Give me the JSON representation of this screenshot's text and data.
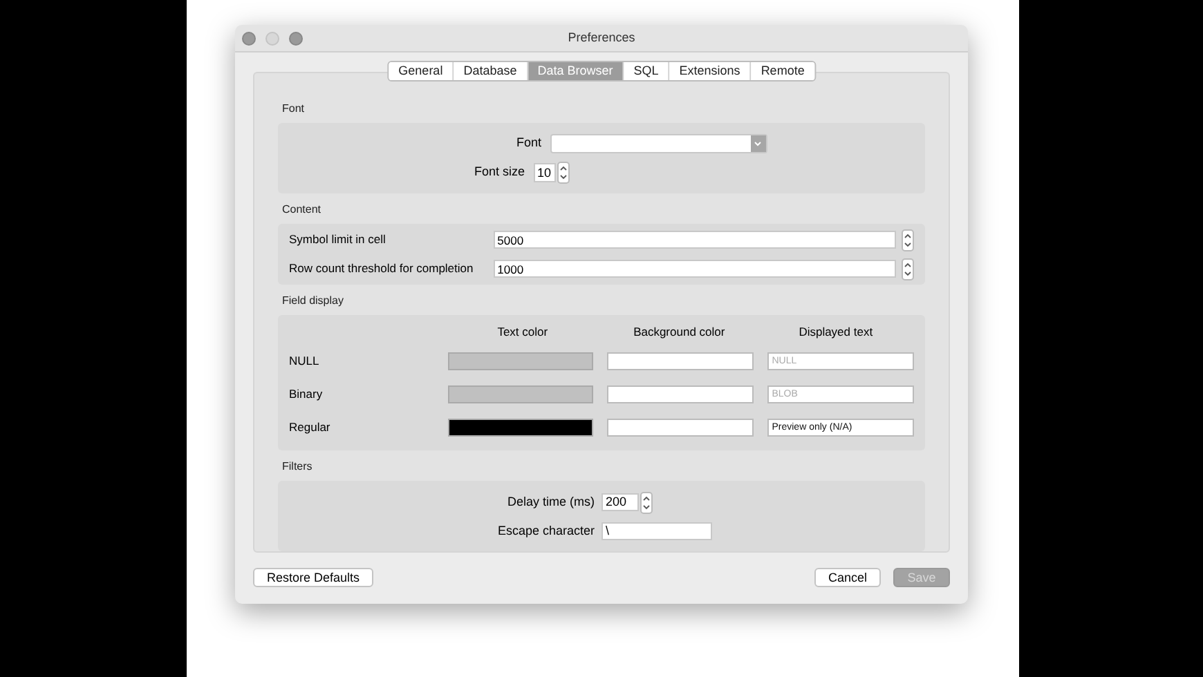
{
  "window": {
    "title": "Preferences"
  },
  "tabs": [
    {
      "label": "General",
      "selected": false
    },
    {
      "label": "Database",
      "selected": false
    },
    {
      "label": "Data Browser",
      "selected": true
    },
    {
      "label": "SQL",
      "selected": false
    },
    {
      "label": "Extensions",
      "selected": false
    },
    {
      "label": "Remote",
      "selected": false
    }
  ],
  "font": {
    "title": "Font",
    "font_label": "Font",
    "font_size_label": "Font size",
    "font_size": "10"
  },
  "content": {
    "title": "Content",
    "rows": [
      {
        "label": "Symbol limit in cell",
        "value": "5000"
      },
      {
        "label": "Row count threshold for completion",
        "value": "1000"
      }
    ]
  },
  "field_display": {
    "title": "Field display",
    "columns": [
      "Text color",
      "Background color",
      "Displayed text"
    ],
    "rows": [
      {
        "label": "NULL",
        "color": "#c0c0c0",
        "text": "NULL"
      },
      {
        "label": "Binary",
        "color": "#c0c0c0",
        "text": "BLOB"
      },
      {
        "label": "Regular",
        "color": "#000000",
        "text": "Preview only (N/A)"
      }
    ]
  },
  "filters": {
    "title": "Filters",
    "delay_label": "Delay time (ms)",
    "delay": "200",
    "escape_label": "Escape character",
    "escape": "\\"
  },
  "buttons": {
    "restore": "Restore Defaults",
    "cancel": "Cancel",
    "save": {
      "label": "Save",
      "disabled": true
    }
  }
}
